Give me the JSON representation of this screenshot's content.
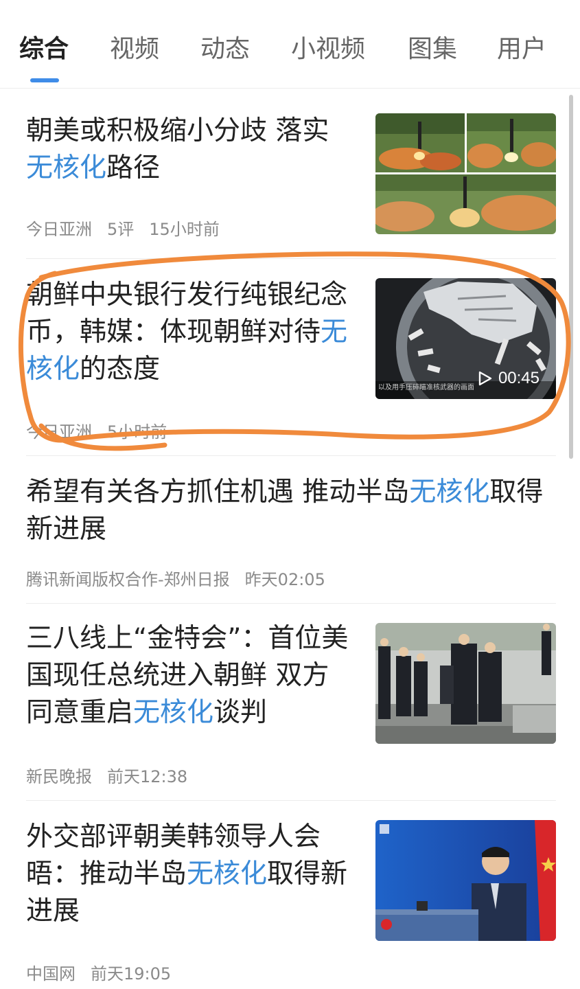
{
  "tabs": [
    {
      "label": "综合",
      "active": true
    },
    {
      "label": "视频"
    },
    {
      "label": "动态"
    },
    {
      "label": "小视频"
    },
    {
      "label": "图集"
    },
    {
      "label": "用户"
    }
  ],
  "accent_color": "#3f8ce8",
  "highlight_color": "#3b8bd8",
  "annotation_color": "#f08a3c",
  "articles": [
    {
      "title_pre": "朝美或积极缩小分歧 落实",
      "title_hl": "无核化",
      "title_post": "路径",
      "source": "今日亚洲",
      "comments": "5评",
      "time": "15小时前",
      "thumb_icon": "missile-launch-collage-thumbnail"
    },
    {
      "title_pre": "朝鲜中央银行发行纯银纪念币，韩媒：体现朝鲜对待",
      "title_hl": "无核化",
      "title_post": "的态度",
      "source": "今日亚洲",
      "time": "5小时前",
      "duration": "00:45",
      "thumb_caption": "以及用手压碎瞄准核武器的画面",
      "thumb_icon": "silver-coin-video-thumbnail"
    },
    {
      "title_pre": "希望有关各方抓住机遇 推动半岛",
      "title_hl": "无核化",
      "title_post": "取得新进展",
      "source": "腾讯新闻版权合作-郑州日报",
      "time": "昨天02:05"
    },
    {
      "title_pre": "三八线上“金特会”：首位美国现任总统进入朝鲜 双方同意重启",
      "title_hl": "无核化",
      "title_post": "谈判",
      "source": "新民晚报",
      "time": "前天12:38",
      "thumb_icon": "leaders-handshake-photo"
    },
    {
      "title_pre": "外交部评朝美韩领导人会晤：推动半岛",
      "title_hl": "无核化",
      "title_post": "取得新进展",
      "source": "中国网",
      "time": "前天19:05",
      "thumb_icon": "press-conference-photo"
    }
  ]
}
